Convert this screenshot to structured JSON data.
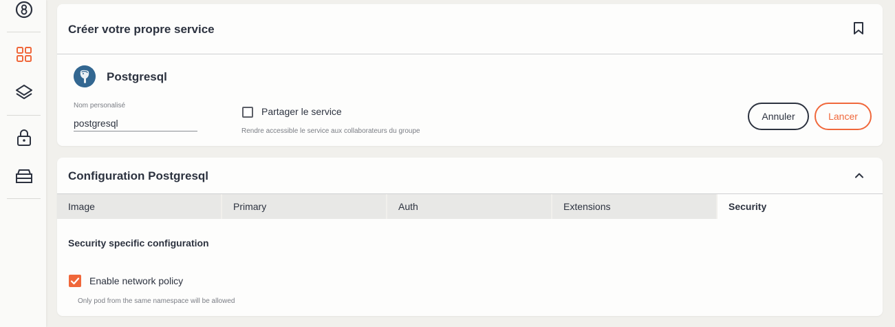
{
  "sidebar": {
    "icons": [
      "catalog-badge-icon",
      "grid-icon",
      "layers-icon",
      "lock-icon",
      "storage-icon"
    ],
    "active_icon": "grid-icon",
    "accent_color": "#f0673a"
  },
  "create_card": {
    "title": "Créer votre propre service",
    "service_name": "Postgresql",
    "custom_name_label": "Nom personalisé",
    "custom_name_value": "postgresql",
    "share_label": "Partager le service",
    "share_checked": false,
    "share_help": "Rendre accessible le service aux collaborateurs du groupe",
    "cancel_label": "Annuler",
    "launch_label": "Lancer"
  },
  "config_card": {
    "title": "Configuration Postgresql",
    "tabs": [
      {
        "label": "Image",
        "active": false
      },
      {
        "label": "Primary",
        "active": false
      },
      {
        "label": "Auth",
        "active": false
      },
      {
        "label": "Extensions",
        "active": false
      },
      {
        "label": "Security",
        "active": true
      }
    ],
    "section_title": "Security specific configuration",
    "network_policy_label": "Enable network policy",
    "network_policy_checked": true,
    "network_policy_help": "Only pod from the same namespace will be allowed"
  }
}
